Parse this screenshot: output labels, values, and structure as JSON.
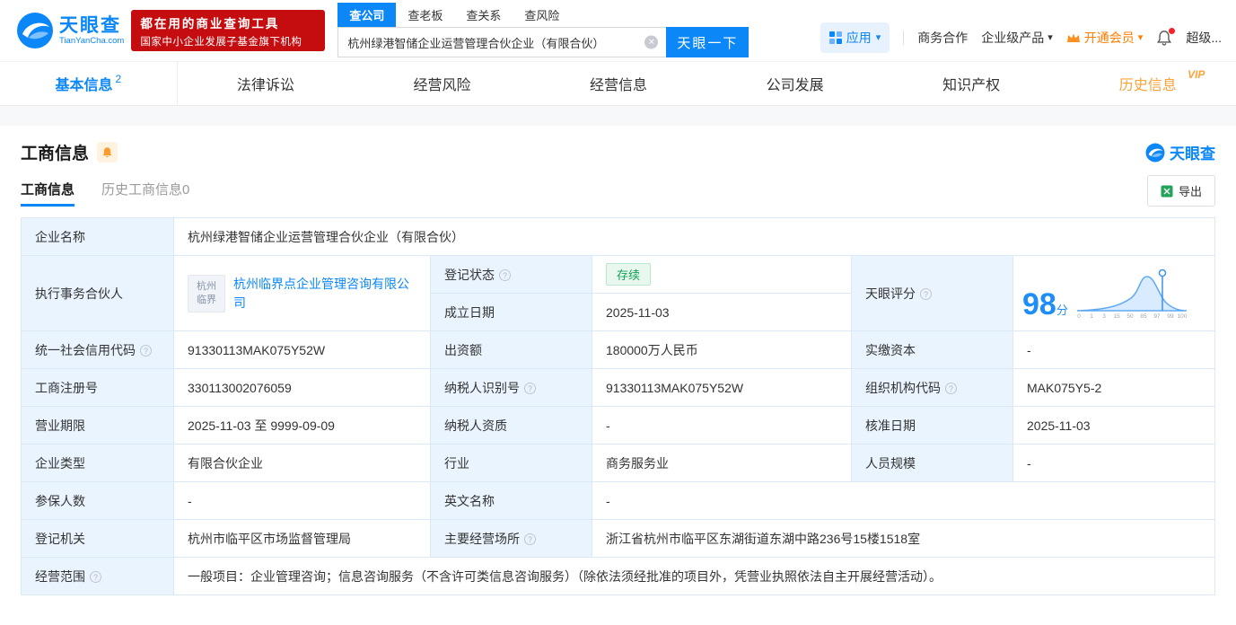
{
  "header": {
    "logo": {
      "title": "天眼查",
      "subtitle": "TianYanCha.com"
    },
    "banner": {
      "line1": "都在用的商业查询工具",
      "line2": "国家中小企业发展子基金旗下机构"
    },
    "search": {
      "tabs": [
        {
          "label": "查公司"
        },
        {
          "label": "查老板"
        },
        {
          "label": "查关系"
        },
        {
          "label": "查风险"
        }
      ],
      "value": "杭州绿港智储企业运营管理合伙企业（有限合伙）",
      "button": "天眼一下"
    },
    "nav": {
      "app": "应用",
      "cooperation": "商务合作",
      "enterprise": "企业级产品",
      "vip": "开通会员",
      "super": "超级..."
    }
  },
  "tabs": {
    "basic": {
      "label": "基本信息",
      "badge": "2"
    },
    "legal": {
      "label": "法律诉讼"
    },
    "risk": {
      "label": "经营风险"
    },
    "operation": {
      "label": "经营信息"
    },
    "development": {
      "label": "公司发展"
    },
    "ip": {
      "label": "知识产权"
    },
    "history": {
      "label": "历史信息",
      "vip_tag": "VIP"
    }
  },
  "section": {
    "title": "工商信息",
    "brand": "天眼查",
    "subtab_current": "工商信息",
    "subtab_history": "历史工商信息0",
    "export": "导出"
  },
  "info": {
    "company_name": {
      "label": "企业名称",
      "value": "杭州绿港智储企业运营管理合伙企业（有限合伙）"
    },
    "partner": {
      "label": "执行事务合伙人",
      "logo_text": "杭州临界",
      "value": "杭州临界点企业管理咨询有限公司"
    },
    "reg_status": {
      "label": "登记状态",
      "value": "存续"
    },
    "establish_date": {
      "label": "成立日期",
      "value": "2025-11-03"
    },
    "score": {
      "label": "天眼评分",
      "value": "98",
      "unit": "分"
    },
    "credit_code": {
      "label": "统一社会信用代码",
      "value": "91330113MAK075Y52W"
    },
    "capital": {
      "label": "出资额",
      "value": "180000万人民币"
    },
    "paid_capital": {
      "label": "实缴资本",
      "value": "-"
    },
    "reg_number": {
      "label": "工商注册号",
      "value": "330113002076059"
    },
    "taxpayer_id": {
      "label": "纳税人识别号",
      "value": "91330113MAK075Y52W"
    },
    "org_code": {
      "label": "组织机构代码",
      "value": "MAK075Y5-2"
    },
    "business_term": {
      "label": "营业期限",
      "value": "2025-11-03 至 9999-09-09"
    },
    "taxpayer_quality": {
      "label": "纳税人资质",
      "value": "-"
    },
    "approval_date": {
      "label": "核准日期",
      "value": "2025-11-03"
    },
    "company_type": {
      "label": "企业类型",
      "value": "有限合伙企业"
    },
    "industry": {
      "label": "行业",
      "value": "商务服务业"
    },
    "staff_size": {
      "label": "人员规模",
      "value": "-"
    },
    "insured_count": {
      "label": "参保人数",
      "value": "-"
    },
    "english_name": {
      "label": "英文名称",
      "value": "-"
    },
    "reg_authority": {
      "label": "登记机关",
      "value": "杭州市临平区市场监督管理局"
    },
    "business_place": {
      "label": "主要经营场所",
      "value": "浙江省杭州市临平区东湖街道东湖中路236号15楼1518室"
    },
    "business_scope": {
      "label": "经营范围",
      "value": "一般项目：企业管理咨询；信息咨询服务（不含许可类信息咨询服务）（除依法须经批准的项目外，凭营业执照依法自主开展经营活动）。"
    }
  },
  "score_chart": {
    "type": "area",
    "ticks": [
      "0",
      "1",
      "3",
      "15",
      "50",
      "85",
      "97",
      "99",
      "100"
    ],
    "marker_value": 98
  },
  "icons": {
    "close": "✕",
    "caret_down": "▾"
  },
  "colors": {
    "brand_blue": "#0b87f7",
    "banner_red": "#c50d10",
    "label_bg": "#e9f4fe",
    "status_green": "#12a256",
    "vip_orange": "#f8a33c"
  }
}
